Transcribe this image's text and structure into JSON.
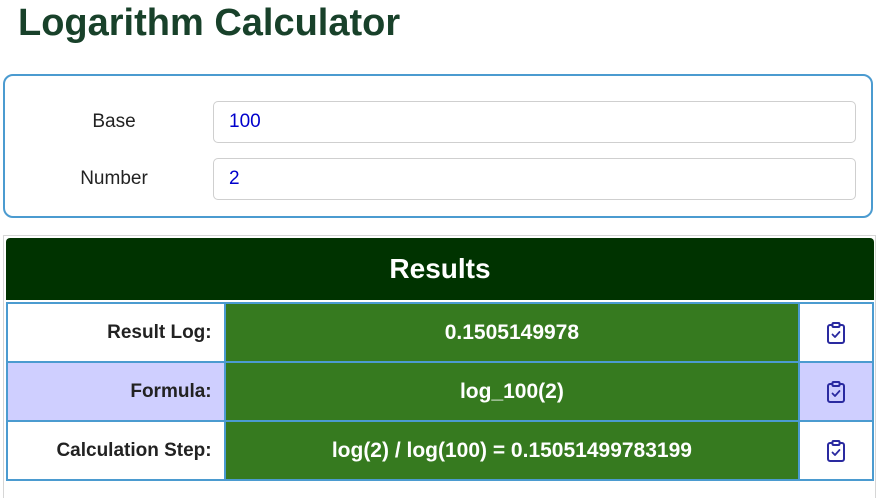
{
  "page": {
    "title": "Logarithm Calculator"
  },
  "inputs": {
    "base": {
      "label": "Base",
      "value": "100"
    },
    "number": {
      "label": "Number",
      "value": "2"
    }
  },
  "results": {
    "header": "Results",
    "rows": [
      {
        "label": "Result Log:",
        "value": "0.1505149978",
        "copy_icon": "clipboard-check-icon"
      },
      {
        "label": "Formula:",
        "value": "log_100(2)",
        "copy_icon": "clipboard-check-icon"
      },
      {
        "label": "Calculation Step:",
        "value": "log(2) / log(100) = 0.15051499783199",
        "copy_icon": "clipboard-check-icon"
      }
    ]
  },
  "colors": {
    "title": "#18412a",
    "card_border": "#4b9bd0",
    "header_bg": "#003300",
    "value_bg": "#367a1f",
    "alt_row_bg": "#cfcfff",
    "input_text": "#0000cc",
    "icon": "#2a2aa0"
  }
}
